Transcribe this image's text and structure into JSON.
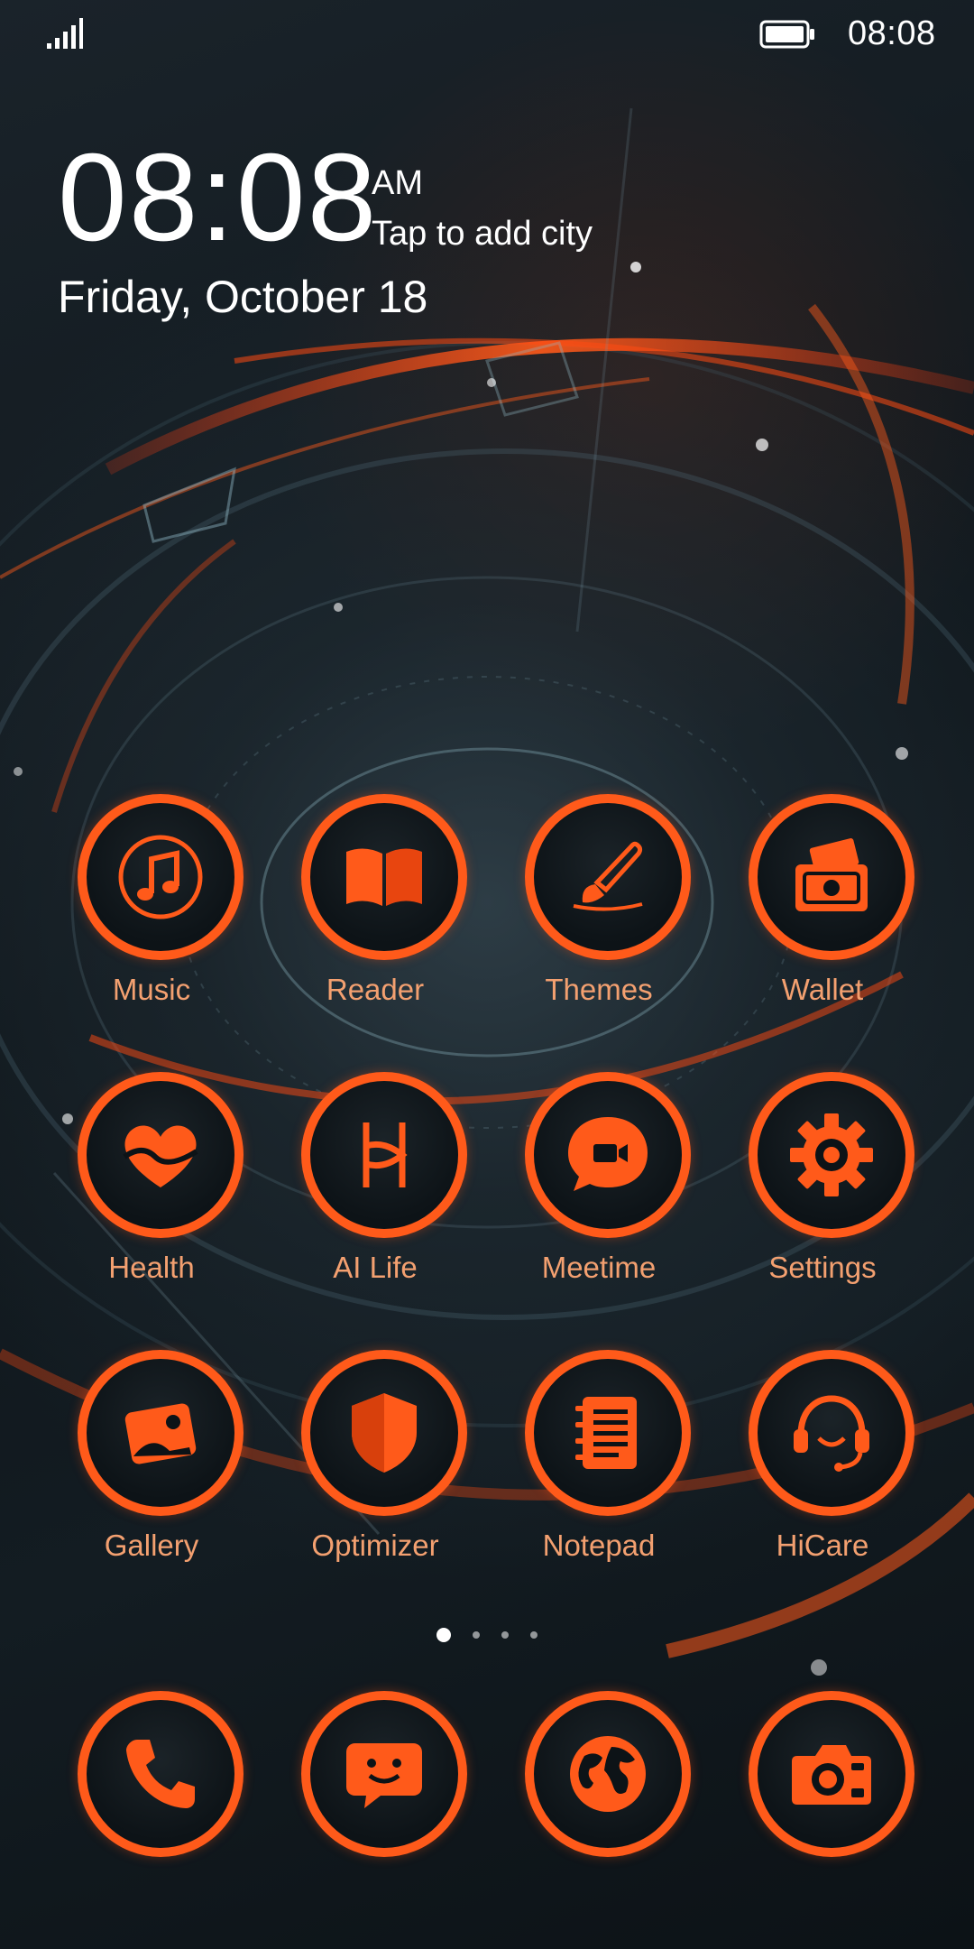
{
  "status_bar": {
    "time": "08:08",
    "signal_icon": "signal-bars-icon",
    "battery_icon": "battery-full-icon"
  },
  "clock_widget": {
    "time": "08:08",
    "ampm": "AM",
    "city_prompt": "Tap to add city",
    "date": "Friday, October 18"
  },
  "apps": [
    {
      "label": "Music",
      "icon": "music-note-icon"
    },
    {
      "label": "Reader",
      "icon": "book-icon"
    },
    {
      "label": "Themes",
      "icon": "paintbrush-icon"
    },
    {
      "label": "Wallet",
      "icon": "wallet-icon"
    },
    {
      "label": "Health",
      "icon": "heart-icon"
    },
    {
      "label": "AI Life",
      "icon": "ai-life-icon"
    },
    {
      "label": "Meetime",
      "icon": "video-chat-icon"
    },
    {
      "label": "Settings",
      "icon": "gear-icon"
    },
    {
      "label": "Gallery",
      "icon": "picture-icon"
    },
    {
      "label": "Optimizer",
      "icon": "shield-icon"
    },
    {
      "label": "Notepad",
      "icon": "notepad-icon"
    },
    {
      "label": "HiCare",
      "icon": "headset-icon"
    }
  ],
  "dock": [
    {
      "name": "phone",
      "icon": "phone-icon"
    },
    {
      "name": "messages",
      "icon": "message-icon"
    },
    {
      "name": "browser",
      "icon": "globe-icon"
    },
    {
      "name": "camera",
      "icon": "camera-icon"
    }
  ],
  "page_indicator": {
    "pages": 4,
    "current": 1
  },
  "colors": {
    "accent": "#ff5a1a",
    "label": "#f3a070",
    "text": "#ffffff",
    "background": "#11181d"
  }
}
